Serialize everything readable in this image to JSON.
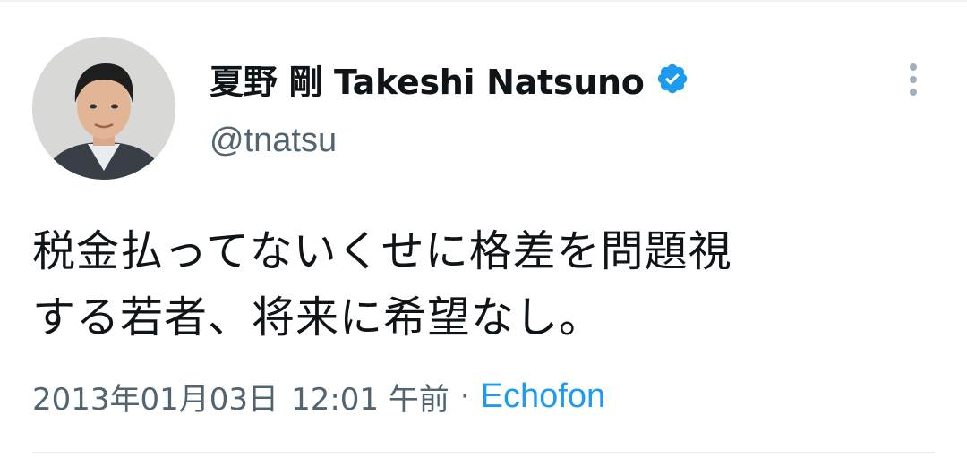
{
  "tweet": {
    "display_name": "夏野 剛 Takeshi Natsuno",
    "handle": "@tnatsu",
    "text_lines": [
      "税金払ってないくせに格差を問題視",
      "する若者、将来に希望なし。"
    ],
    "date": "2013年01月03日",
    "time": "12:01 午前",
    "separator": "·",
    "source": "Echofon",
    "verified_icon": "verified-badge-icon",
    "more_icon": "vertical-ellipsis-icon"
  },
  "colors": {
    "accent": "#1d9bf0",
    "secondary_text": "#536471",
    "primary_text": "#0f1419"
  }
}
